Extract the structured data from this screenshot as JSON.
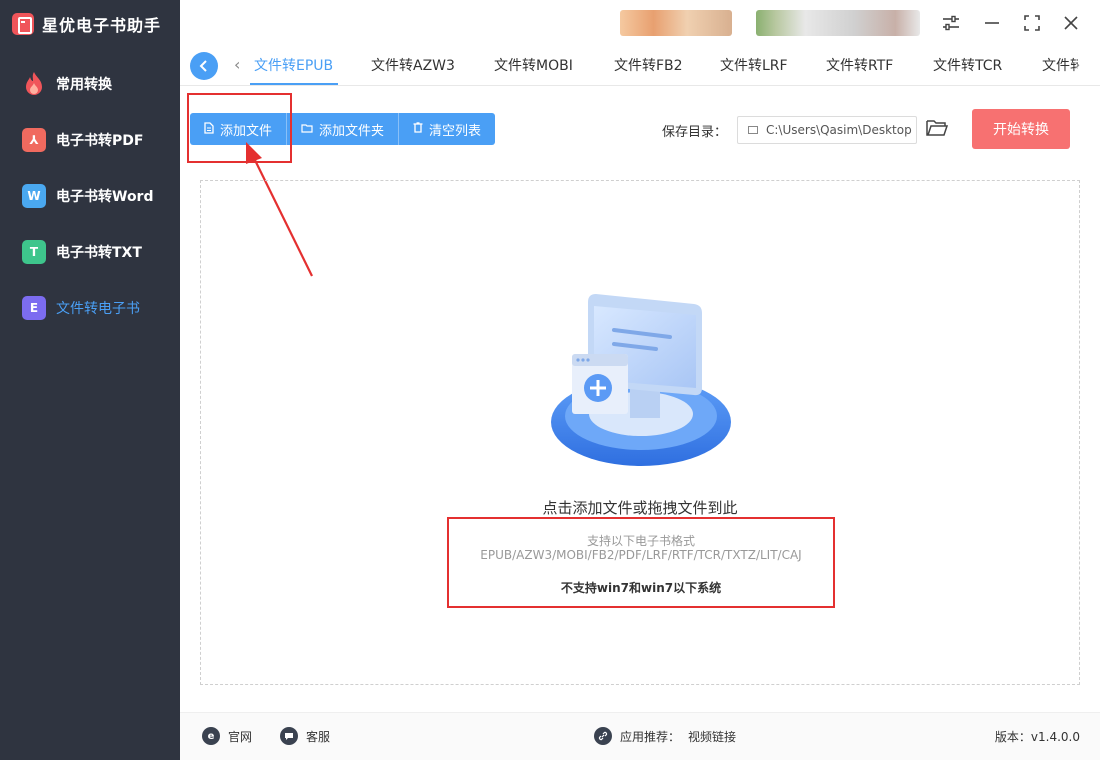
{
  "app": {
    "title": "星优电子书助手"
  },
  "sidebar": {
    "items": [
      {
        "label": "常用转换",
        "icon": "fire-icon"
      },
      {
        "label": "电子书转PDF",
        "icon": "pdf-icon",
        "glyph": "⅄"
      },
      {
        "label": "电子书转Word",
        "icon": "word-icon",
        "glyph": "W"
      },
      {
        "label": "电子书转TXT",
        "icon": "txt-icon",
        "glyph": "T"
      },
      {
        "label": "文件转电子书",
        "icon": "ebook-icon",
        "glyph": "E",
        "active": true
      }
    ]
  },
  "tabs": {
    "items": [
      "文件转EPUB",
      "文件转AZW3",
      "文件转MOBI",
      "文件转FB2",
      "文件转LRF",
      "文件转RTF",
      "文件转TCR",
      "文件转"
    ],
    "active": "文件转EPUB"
  },
  "toolbar": {
    "add_file": "添加文件",
    "add_folder": "添加文件夹",
    "clear_list": "清空列表",
    "save_label": "保存目录：",
    "save_path": "C:\\Users\\Qasim\\Desktop",
    "start": "开始转换"
  },
  "dropzone": {
    "main": "点击添加文件或拖拽文件到此",
    "formats_title": "支持以下电子书格式",
    "formats_list": "EPUB/AZW3/MOBI/FB2/PDF/LRF/RTF/TCR/TXTZ/LIT/CAJ",
    "note": "不支持win7和win7以下系统"
  },
  "footer": {
    "website": "官网",
    "service": "客服",
    "recommend_label": "应用推荐：",
    "recommend_value": "视频链接",
    "version": "版本：v1.4.0.0"
  },
  "colors": {
    "accent": "#4a9ff5",
    "sidebar_bg": "#2f3440",
    "start_button": "#f77171",
    "annotation_red": "#e43030"
  }
}
